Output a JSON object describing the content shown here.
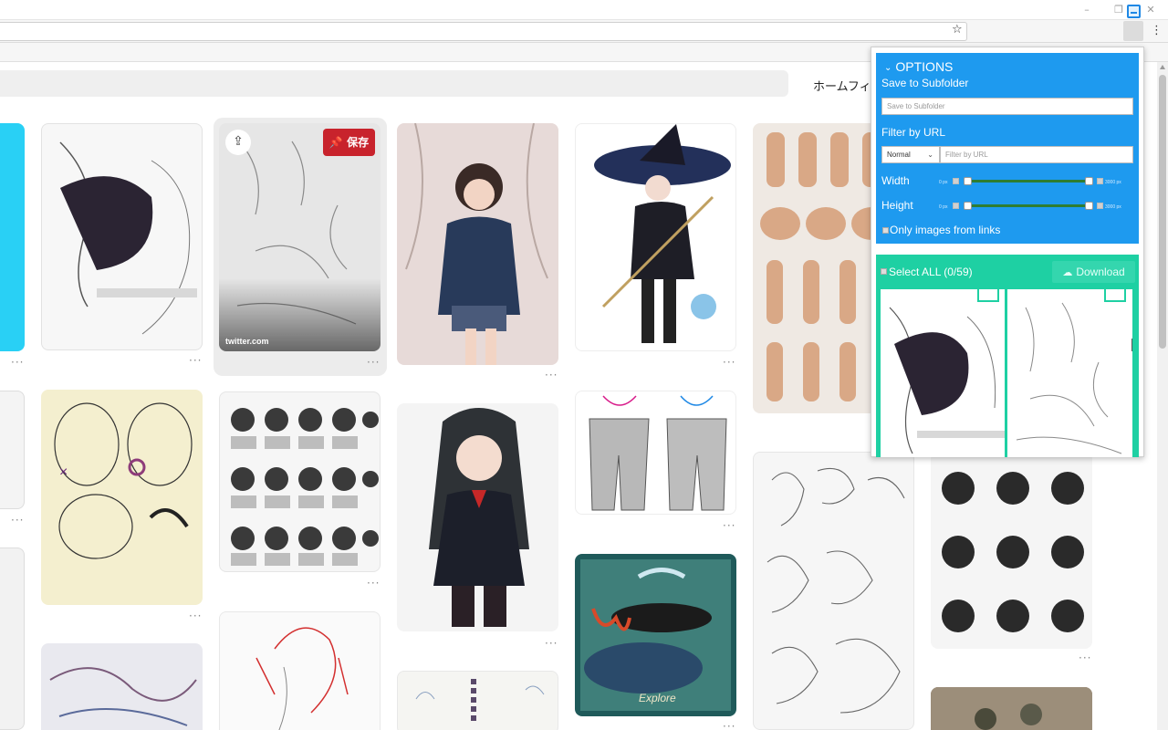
{
  "browser": {
    "window_controls": [
      "–",
      "❐",
      "✕"
    ],
    "bookmark_icon": "star-icon",
    "extension_icon": "image-downloader-icon",
    "menu_icon": "kebab-menu-icon"
  },
  "page": {
    "nav": {
      "home_feed": "ホームフィー"
    },
    "hover_pin": {
      "save_label": "保存",
      "source": "twitter.com"
    },
    "pin_more": "···"
  },
  "extension": {
    "options": {
      "title": "OPTIONS",
      "save_to_subfolder_label": "Save to Subfolder",
      "save_to_subfolder_placeholder": "Save to Subfolder",
      "filter_by_url_label": "Filter by URL",
      "filter_mode": "Normal",
      "filter_url_placeholder": "Filter by URL",
      "width_label": "Width",
      "height_label": "Height",
      "range_min": "0 px",
      "range_max": "3000 px",
      "only_links_label": "Only images from links"
    },
    "selection": {
      "select_all_label": "Select ALL (0/59)",
      "download_label": "Download"
    }
  },
  "colors": {
    "options_bg": "#1e9aef",
    "selection_bg": "#1ed0a3",
    "save_red": "#c8232c"
  }
}
